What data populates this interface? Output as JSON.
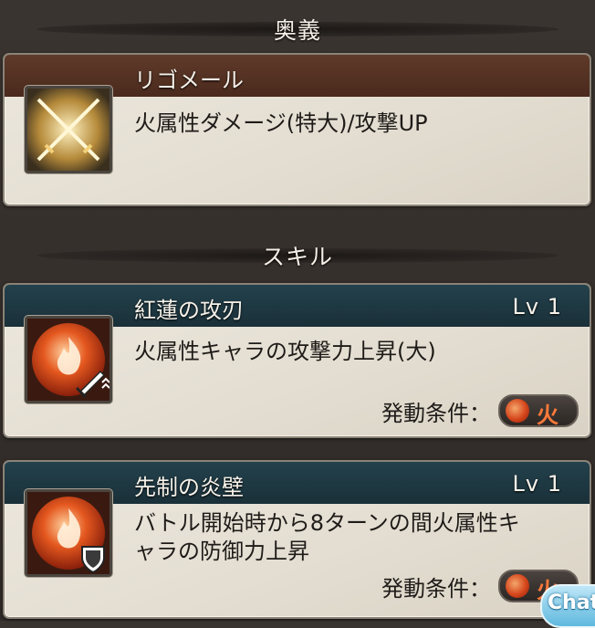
{
  "ougi_section": {
    "title": "奥義"
  },
  "ougi": {
    "name": "リゴメール",
    "description": "火属性ダメージ(特大)/攻撃UP",
    "icon": "crossed-swords-icon"
  },
  "skill_section": {
    "title": "スキル"
  },
  "skills": [
    {
      "name": "紅蓮の攻刃",
      "level": "Lv 1",
      "description_lines": [
        "火属性キャラの攻撃力上昇(大)"
      ],
      "condition_label": "発動条件：",
      "element": "火",
      "icon": "fire-sword-icon"
    },
    {
      "name": "先制の炎壁",
      "level": "Lv 1",
      "description_lines": [
        "バトル開始時から8ターンの間火属性キ",
        "ャラの防御力上昇"
      ],
      "condition_label": "発動条件：",
      "element": "火",
      "icon": "fire-shield-icon"
    }
  ],
  "chat_button": {
    "label": "Chat"
  },
  "colors": {
    "fire": "#d5451b",
    "ougi_header": "#4a2a1d",
    "skill_header": "#1a3039"
  }
}
